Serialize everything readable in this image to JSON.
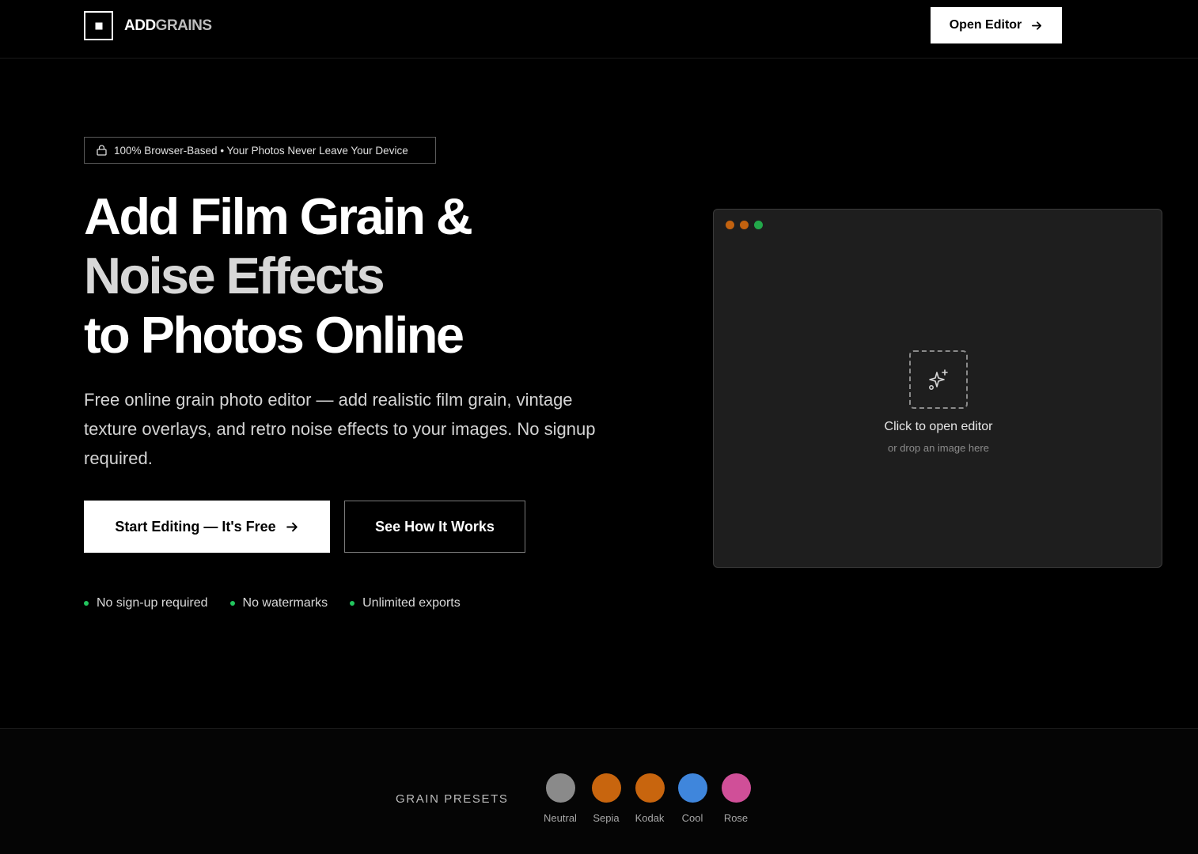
{
  "header": {
    "logo_part1": "ADD",
    "logo_part2": "GRAINS",
    "open_editor_label": "Open Editor",
    "arrow_icon": "arrow-right-icon"
  },
  "hero": {
    "badge_icon": "lock-icon",
    "badge_text": "100% Browser-Based • Your Photos Never Leave Your Device",
    "headline_line1": "Add Film Grain &",
    "headline_line2": "Noise Effects",
    "headline_line3": "to Photos Online",
    "subtext": "Free online grain photo editor — add realistic film grain, vintage texture overlays, and retro noise effects to your images. No signup required.",
    "primary_button": "Start Editing — It's Free",
    "secondary_button": "See How It Works",
    "features": [
      "No sign-up required",
      "No watermarks",
      "Unlimited exports"
    ],
    "feature_dot_color": "#22c55e"
  },
  "editor": {
    "window_dot_colors": [
      "#c2620f",
      "#c2620f",
      "#22a84a"
    ],
    "drop_icon": "sparkles-icon",
    "title": "Click to open editor",
    "subtitle": "or drop an image here"
  },
  "presets": {
    "label": "GRAIN PRESETS",
    "items": [
      {
        "label": "Neutral",
        "color": "#8a8a8a"
      },
      {
        "label": "Sepia",
        "color": "#c8650e"
      },
      {
        "label": "Kodak",
        "color": "#c8650e"
      },
      {
        "label": "Cool",
        "color": "#3f86dc"
      },
      {
        "label": "Rose",
        "color": "#d04f98"
      }
    ]
  }
}
